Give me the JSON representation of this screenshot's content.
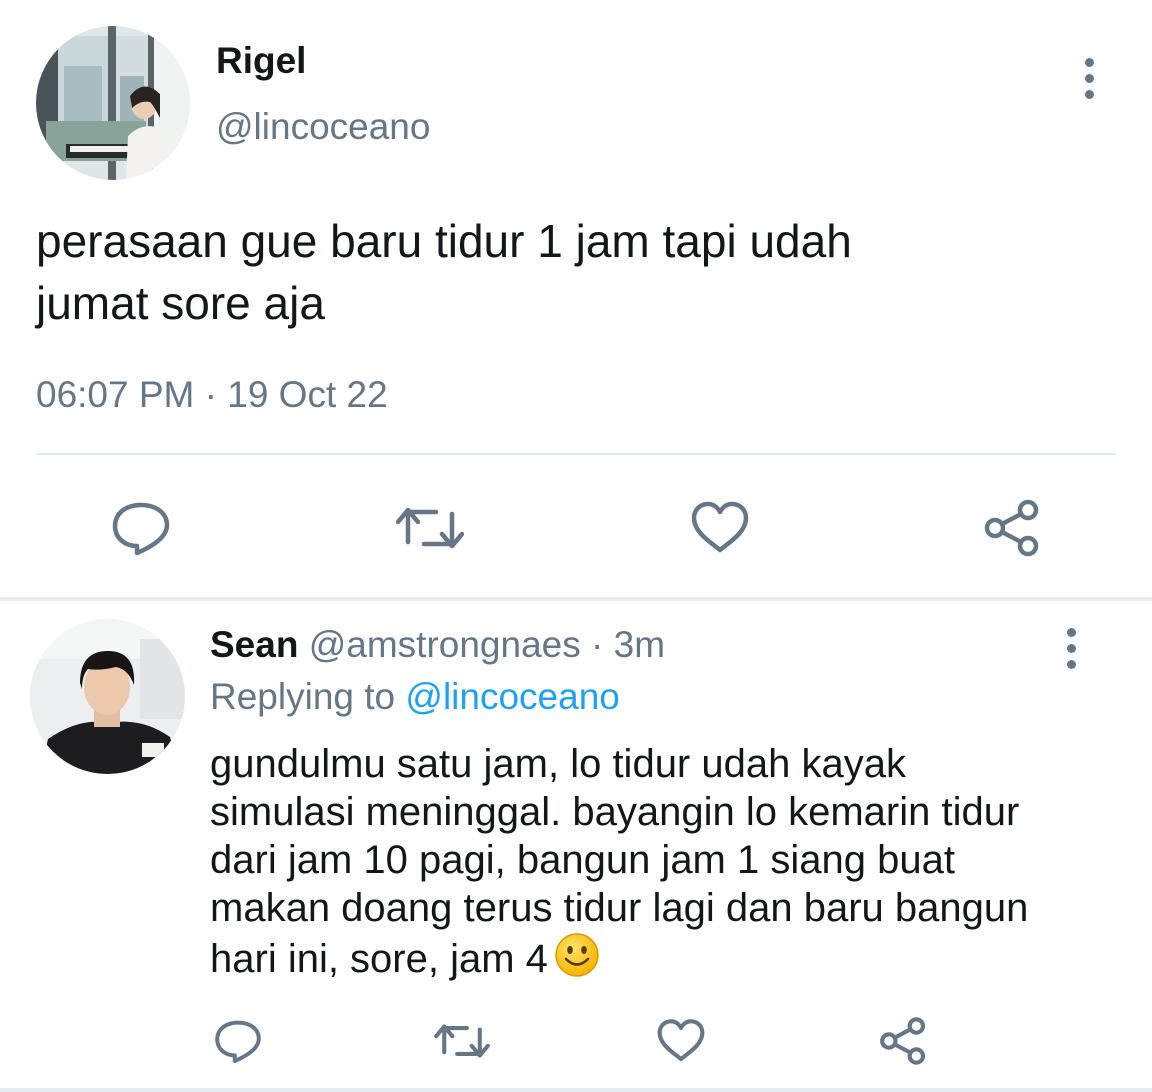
{
  "main_tweet": {
    "author_name": "Rigel",
    "author_handle": "@lincoceano",
    "text_lines": [
      "perasaan gue baru tidur 1 jam tapi udah",
      "jumat sore aja"
    ],
    "timestamp": "06:07 PM · 19 Oct 22",
    "more_icon": "more-vertical-icon",
    "actions": [
      "reply-icon",
      "retweet-icon",
      "like-icon",
      "share-icon"
    ]
  },
  "reply": {
    "author_name": "Sean",
    "author_handle": "@amstrongnaes",
    "separator": "·",
    "time": "3m",
    "replying_prefix": "Replying to",
    "replying_mention": "@lincoceano",
    "text_lines": [
      "gundulmu satu jam, lo tidur udah kayak",
      "simulasi meninggal. bayangin lo kemarin tidur",
      "dari jam 10 pagi, bangun jam 1 siang buat",
      "makan doang terus tidur lagi dan baru bangun",
      "hari ini, sore, jam 4"
    ],
    "emoji": "slightly-smiling-face",
    "actions": [
      "reply-icon",
      "retweet-icon",
      "like-icon",
      "share-icon"
    ]
  },
  "colors": {
    "text": "#14171a",
    "secondary": "#657786",
    "link": "#1da1f2",
    "divider": "#e6ecf0",
    "icon": "#657786"
  }
}
